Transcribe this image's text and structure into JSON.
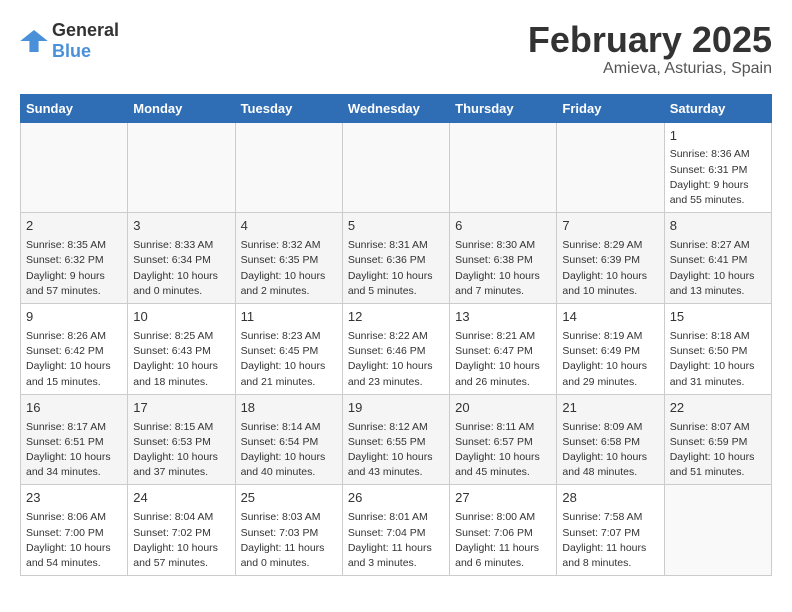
{
  "logo": {
    "general": "General",
    "blue": "Blue"
  },
  "title": "February 2025",
  "subtitle": "Amieva, Asturias, Spain",
  "weekdays": [
    "Sunday",
    "Monday",
    "Tuesday",
    "Wednesday",
    "Thursday",
    "Friday",
    "Saturday"
  ],
  "weeks": [
    [
      {
        "day": "",
        "info": ""
      },
      {
        "day": "",
        "info": ""
      },
      {
        "day": "",
        "info": ""
      },
      {
        "day": "",
        "info": ""
      },
      {
        "day": "",
        "info": ""
      },
      {
        "day": "",
        "info": ""
      },
      {
        "day": "1",
        "info": "Sunrise: 8:36 AM\nSunset: 6:31 PM\nDaylight: 9 hours\nand 55 minutes."
      }
    ],
    [
      {
        "day": "2",
        "info": "Sunrise: 8:35 AM\nSunset: 6:32 PM\nDaylight: 9 hours\nand 57 minutes."
      },
      {
        "day": "3",
        "info": "Sunrise: 8:33 AM\nSunset: 6:34 PM\nDaylight: 10 hours\nand 0 minutes."
      },
      {
        "day": "4",
        "info": "Sunrise: 8:32 AM\nSunset: 6:35 PM\nDaylight: 10 hours\nand 2 minutes."
      },
      {
        "day": "5",
        "info": "Sunrise: 8:31 AM\nSunset: 6:36 PM\nDaylight: 10 hours\nand 5 minutes."
      },
      {
        "day": "6",
        "info": "Sunrise: 8:30 AM\nSunset: 6:38 PM\nDaylight: 10 hours\nand 7 minutes."
      },
      {
        "day": "7",
        "info": "Sunrise: 8:29 AM\nSunset: 6:39 PM\nDaylight: 10 hours\nand 10 minutes."
      },
      {
        "day": "8",
        "info": "Sunrise: 8:27 AM\nSunset: 6:41 PM\nDaylight: 10 hours\nand 13 minutes."
      }
    ],
    [
      {
        "day": "9",
        "info": "Sunrise: 8:26 AM\nSunset: 6:42 PM\nDaylight: 10 hours\nand 15 minutes."
      },
      {
        "day": "10",
        "info": "Sunrise: 8:25 AM\nSunset: 6:43 PM\nDaylight: 10 hours\nand 18 minutes."
      },
      {
        "day": "11",
        "info": "Sunrise: 8:23 AM\nSunset: 6:45 PM\nDaylight: 10 hours\nand 21 minutes."
      },
      {
        "day": "12",
        "info": "Sunrise: 8:22 AM\nSunset: 6:46 PM\nDaylight: 10 hours\nand 23 minutes."
      },
      {
        "day": "13",
        "info": "Sunrise: 8:21 AM\nSunset: 6:47 PM\nDaylight: 10 hours\nand 26 minutes."
      },
      {
        "day": "14",
        "info": "Sunrise: 8:19 AM\nSunset: 6:49 PM\nDaylight: 10 hours\nand 29 minutes."
      },
      {
        "day": "15",
        "info": "Sunrise: 8:18 AM\nSunset: 6:50 PM\nDaylight: 10 hours\nand 31 minutes."
      }
    ],
    [
      {
        "day": "16",
        "info": "Sunrise: 8:17 AM\nSunset: 6:51 PM\nDaylight: 10 hours\nand 34 minutes."
      },
      {
        "day": "17",
        "info": "Sunrise: 8:15 AM\nSunset: 6:53 PM\nDaylight: 10 hours\nand 37 minutes."
      },
      {
        "day": "18",
        "info": "Sunrise: 8:14 AM\nSunset: 6:54 PM\nDaylight: 10 hours\nand 40 minutes."
      },
      {
        "day": "19",
        "info": "Sunrise: 8:12 AM\nSunset: 6:55 PM\nDaylight: 10 hours\nand 43 minutes."
      },
      {
        "day": "20",
        "info": "Sunrise: 8:11 AM\nSunset: 6:57 PM\nDaylight: 10 hours\nand 45 minutes."
      },
      {
        "day": "21",
        "info": "Sunrise: 8:09 AM\nSunset: 6:58 PM\nDaylight: 10 hours\nand 48 minutes."
      },
      {
        "day": "22",
        "info": "Sunrise: 8:07 AM\nSunset: 6:59 PM\nDaylight: 10 hours\nand 51 minutes."
      }
    ],
    [
      {
        "day": "23",
        "info": "Sunrise: 8:06 AM\nSunset: 7:00 PM\nDaylight: 10 hours\nand 54 minutes."
      },
      {
        "day": "24",
        "info": "Sunrise: 8:04 AM\nSunset: 7:02 PM\nDaylight: 10 hours\nand 57 minutes."
      },
      {
        "day": "25",
        "info": "Sunrise: 8:03 AM\nSunset: 7:03 PM\nDaylight: 11 hours\nand 0 minutes."
      },
      {
        "day": "26",
        "info": "Sunrise: 8:01 AM\nSunset: 7:04 PM\nDaylight: 11 hours\nand 3 minutes."
      },
      {
        "day": "27",
        "info": "Sunrise: 8:00 AM\nSunset: 7:06 PM\nDaylight: 11 hours\nand 6 minutes."
      },
      {
        "day": "28",
        "info": "Sunrise: 7:58 AM\nSunset: 7:07 PM\nDaylight: 11 hours\nand 8 minutes."
      },
      {
        "day": "",
        "info": ""
      }
    ]
  ]
}
